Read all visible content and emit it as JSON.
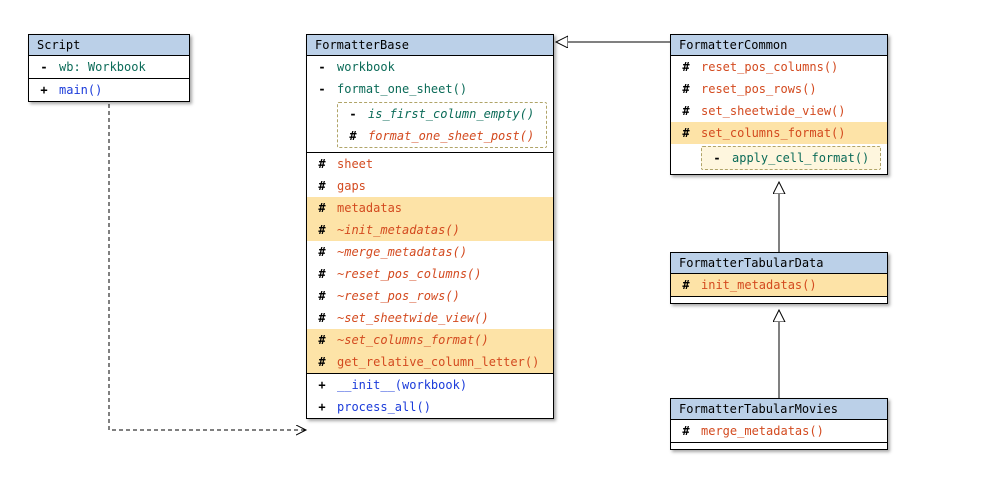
{
  "classes": {
    "script": {
      "title": "Script",
      "members": {
        "wb": {
          "vis": "-",
          "text": "wb: Workbook",
          "color": "priv"
        },
        "main": {
          "vis": "+",
          "text": "main()",
          "color": "pub"
        }
      }
    },
    "formatterbase": {
      "title": "FormatterBase",
      "members": {
        "workbook": {
          "vis": "-",
          "text": "workbook",
          "color": "priv"
        },
        "format_one_sheet": {
          "vis": "-",
          "text": "format_one_sheet()",
          "color": "priv"
        },
        "is_first_column_empty": {
          "vis": "-",
          "text": "is_first_column_empty()",
          "color": "priv",
          "italic": true
        },
        "format_one_sheet_post": {
          "vis": "#",
          "text": "format_one_sheet_post()",
          "color": "prot",
          "italic": true
        },
        "sheet": {
          "vis": "#",
          "text": "sheet",
          "color": "prot"
        },
        "gaps": {
          "vis": "#",
          "text": "gaps",
          "color": "prot"
        },
        "metadatas": {
          "vis": "#",
          "text": "metadatas",
          "color": "prot"
        },
        "init_metadatas": {
          "vis": "#",
          "text": "~init_metadatas()",
          "color": "prot",
          "italic": true
        },
        "merge_metadatas": {
          "vis": "#",
          "text": "~merge_metadatas()",
          "color": "prot",
          "italic": true
        },
        "reset_pos_columns": {
          "vis": "#",
          "text": "~reset_pos_columns()",
          "color": "prot",
          "italic": true
        },
        "reset_pos_rows": {
          "vis": "#",
          "text": "~reset_pos_rows()",
          "color": "prot",
          "italic": true
        },
        "set_sheetwide_view": {
          "vis": "#",
          "text": "~set_sheetwide_view()",
          "color": "prot",
          "italic": true
        },
        "set_columns_format": {
          "vis": "#",
          "text": "~set_columns_format()",
          "color": "prot",
          "italic": true
        },
        "get_relative_column_letter": {
          "vis": "#",
          "text": "get_relative_column_letter()",
          "color": "prot"
        },
        "init": {
          "vis": "+",
          "text": "__init__(workbook)",
          "color": "pub"
        },
        "process_all": {
          "vis": "+",
          "text": "process_all()",
          "color": "pub"
        }
      }
    },
    "formattercommon": {
      "title": "FormatterCommon",
      "members": {
        "reset_pos_columns": {
          "vis": "#",
          "text": "reset_pos_columns()",
          "color": "prot"
        },
        "reset_pos_rows": {
          "vis": "#",
          "text": "reset_pos_rows()",
          "color": "prot"
        },
        "set_sheetwide_view": {
          "vis": "#",
          "text": "set_sheetwide_view()",
          "color": "prot"
        },
        "set_columns_format": {
          "vis": "#",
          "text": "set_columns_format()",
          "color": "prot"
        },
        "apply_cell_format": {
          "vis": "-",
          "text": "apply_cell_format()",
          "color": "priv"
        }
      }
    },
    "formattertabulardata": {
      "title": "FormatterTabularData",
      "members": {
        "init_metadatas": {
          "vis": "#",
          "text": "init_metadatas()",
          "color": "prot"
        }
      }
    },
    "formattertabularmovies": {
      "title": "FormatterTabularMovies",
      "members": {
        "merge_metadatas": {
          "vis": "#",
          "text": "merge_metadatas()",
          "color": "prot"
        }
      }
    }
  },
  "relationships": [
    {
      "from": "Script",
      "to": "FormatterBase",
      "type": "dependency",
      "style": "dashed-open-arrow"
    },
    {
      "from": "FormatterCommon",
      "to": "FormatterBase",
      "type": "inheritance",
      "style": "solid-closed-arrow"
    },
    {
      "from": "FormatterTabularData",
      "to": "FormatterCommon",
      "type": "inheritance",
      "style": "solid-closed-arrow"
    },
    {
      "from": "FormatterTabularMovies",
      "to": "FormatterTabularData",
      "type": "inheritance",
      "style": "solid-closed-arrow"
    }
  ],
  "colors": {
    "title_bg": "#BBD0E8",
    "highlight_bg": "#FDE3A7",
    "private": "#0B6B58",
    "protected": "#D34A1F",
    "public": "#1B3BDA"
  }
}
